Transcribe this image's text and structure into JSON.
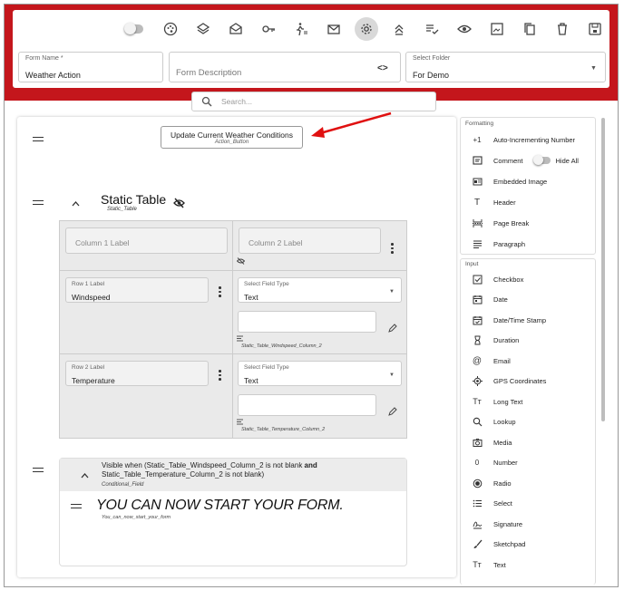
{
  "header": {
    "form_name_label": "Form Name *",
    "form_name_value": "Weather Action",
    "form_description_placeholder": "Form Description",
    "select_folder_label": "Select Folder",
    "select_folder_value": "For Demo"
  },
  "toolbar": {
    "icons": [
      "toggle-switch",
      "palette-icon",
      "layers-icon",
      "open-mail-icon",
      "key-icon",
      "walk-icon",
      "mail-icon",
      "gear-icon",
      "upload-icon",
      "checklist-icon",
      "eye-icon",
      "image-icon",
      "copy-icon",
      "trash-icon",
      "save-icon"
    ]
  },
  "search": {
    "placeholder": "Search..."
  },
  "action_button": {
    "label": "Update Current Weather Conditions",
    "sub": "Action_Button"
  },
  "static_table": {
    "title": "Static Table",
    "sub": "Static_Table",
    "column1_placeholder": "Column 1 Label",
    "column2_placeholder": "Column 2 Label",
    "rows": [
      {
        "label_caption": "Row 1 Label",
        "value": "Windspeed",
        "type_caption": "Select Field Type",
        "type_value": "Text",
        "field_id": "Static_Table_Windspeed_Column_2"
      },
      {
        "label_caption": "Row 2 Label",
        "value": "Temperature",
        "type_caption": "Select Field Type",
        "type_value": "Text",
        "field_id": "Static_Table_Temperature_Column_2"
      }
    ]
  },
  "conditional": {
    "line1_prefix": "Visible when (Static_Table_Windspeed_Column_2 is not blank ",
    "line1_bold": "and",
    "line2": "Static_Table_Temperature_Column_2 is not blank)",
    "sub": "Conditional_Field",
    "header_text": "YOU CAN NOW START YOUR FORM.",
    "header_sub": "You_can_now_start_your_form"
  },
  "formatting": {
    "title": "Formatting",
    "items": [
      {
        "icon": "+1",
        "label": "Auto-Incrementing Number"
      },
      {
        "icon": "comment-icon",
        "label": "Comment"
      },
      {
        "icon": "embedded-image-icon",
        "label": "Embedded Image"
      },
      {
        "icon": "header-icon",
        "label": "Header"
      },
      {
        "icon": "page-break-icon",
        "label": "Page Break"
      },
      {
        "icon": "paragraph-icon",
        "label": "Paragraph"
      }
    ],
    "hide_all_label": "Hide All"
  },
  "input": {
    "title": "Input",
    "items": [
      {
        "icon": "checkbox-icon",
        "label": "Checkbox"
      },
      {
        "icon": "calendar-icon",
        "label": "Date"
      },
      {
        "icon": "calendar-check-icon",
        "label": "Date/Time Stamp"
      },
      {
        "icon": "hourglass-icon",
        "label": "Duration"
      },
      {
        "icon": "at-icon",
        "label": "Email"
      },
      {
        "icon": "gps-icon",
        "label": "GPS Coordinates"
      },
      {
        "icon": "long-text-icon",
        "label": "Long Text"
      },
      {
        "icon": "magnifier-icon",
        "label": "Lookup"
      },
      {
        "icon": "camera-icon",
        "label": "Media"
      },
      {
        "icon": "0",
        "label": "Number"
      },
      {
        "icon": "radio-icon",
        "label": "Radio"
      },
      {
        "icon": "list-icon",
        "label": "Select"
      },
      {
        "icon": "signature-icon",
        "label": "Signature"
      },
      {
        "icon": "brush-icon",
        "label": "Sketchpad"
      },
      {
        "icon": "text-icon",
        "label": "Text"
      }
    ]
  },
  "colors": {
    "brand_red": "#c4161c",
    "annotation_arrow": "#e01010"
  }
}
